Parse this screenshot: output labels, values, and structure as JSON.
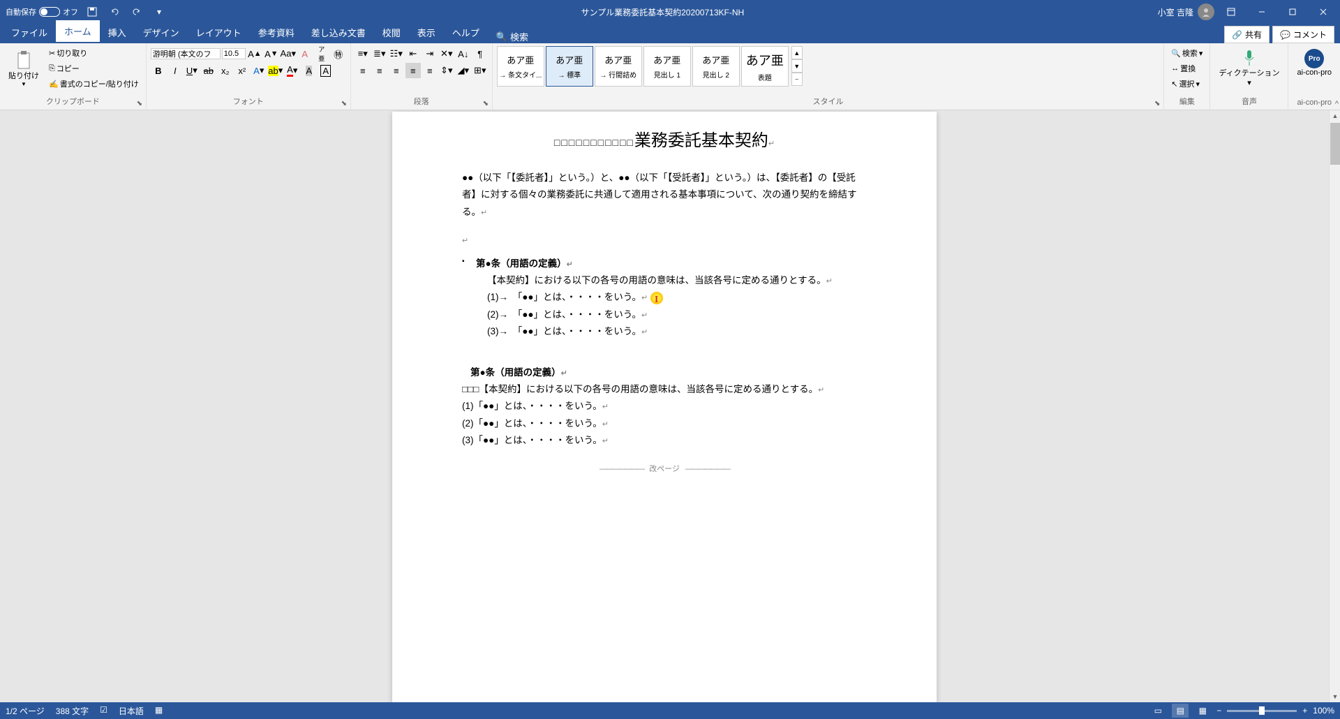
{
  "titlebar": {
    "autosave_label": "自動保存",
    "autosave_state": "オフ",
    "doc_title": "サンプル業務委託基本契約20200713KF-NH",
    "user_name": "小室 吉隆"
  },
  "tabs": {
    "file": "ファイル",
    "home": "ホーム",
    "insert": "挿入",
    "design": "デザイン",
    "layout": "レイアウト",
    "references": "参考資料",
    "mailings": "差し込み文書",
    "review": "校閲",
    "view": "表示",
    "help": "ヘルプ",
    "search": "検索",
    "share": "共有",
    "comment": "コメント"
  },
  "ribbon": {
    "clipboard": {
      "paste": "貼り付け",
      "cut": "切り取り",
      "copy": "コピー",
      "format_painter": "書式のコピー/貼り付け",
      "label": "クリップボード"
    },
    "font": {
      "name": "游明朝 (本文のフ",
      "size": "10.5",
      "label": "フォント"
    },
    "paragraph": {
      "label": "段落"
    },
    "styles": {
      "label": "スタイル",
      "items": [
        {
          "preview": "あア亜",
          "name": "→ 条文タイ..."
        },
        {
          "preview": "あア亜",
          "name": "→ 標準"
        },
        {
          "preview": "あア亜",
          "name": "→ 行間詰め"
        },
        {
          "preview": "あア亜",
          "name": "見出し 1"
        },
        {
          "preview": "あア亜",
          "name": "見出し 2"
        },
        {
          "preview": "あア亜",
          "name": "表題"
        }
      ]
    },
    "editing": {
      "find": "検索",
      "replace": "置換",
      "select": "選択",
      "label": "編集"
    },
    "voice": {
      "dictate": "ディクテーション",
      "label": "音声"
    },
    "addin": {
      "name": "ai-con-pro",
      "label": "ai-con-pro",
      "icon": "Pro"
    }
  },
  "document": {
    "title_blanks": "□□□□□□□□□□□",
    "title": "業務委託基本契約",
    "intro": "●●（以下「【委託者】」という。）と、●●（以下「【受託者】」という。）は、【委託者】の【受託者】に対する個々の業務委託に共通して適用される基本事項について、次の通り契約を締結する。",
    "section1_title": "第●条（用語の定義）",
    "section1_body": "【本契約】における以下の各号の用語の意味は、当該各号に定める通りとする。",
    "def1": "(1)→　「●●」とは、・・・・をいう。",
    "def2": "(2)→　「●●」とは、・・・・をいう。",
    "def3": "(3)→　「●●」とは、・・・・をいう。",
    "section2_title": "第●条（用語の定義）",
    "section2_blanks": "□□□",
    "section2_body": "【本契約】における以下の各号の用語の意味は、当該各号に定める通りとする。",
    "def2_1": "(1)「●●」とは、・・・・をいう。",
    "def2_2": "(2)「●●」とは、・・・・をいう。",
    "def2_3": "(3)「●●」とは、・・・・をいう。",
    "page_break": "改ページ"
  },
  "statusbar": {
    "page": "1/2 ページ",
    "words": "388 文字",
    "language": "日本語",
    "zoom": "100%"
  }
}
